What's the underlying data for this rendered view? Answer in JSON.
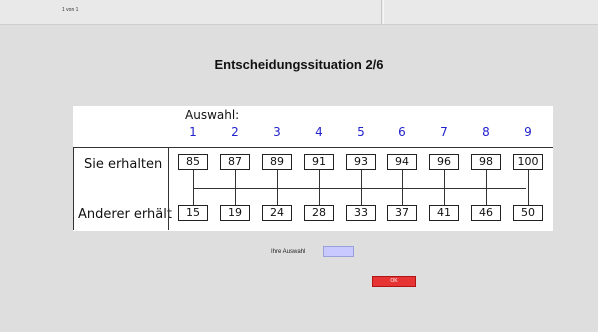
{
  "header": {
    "period_text": "1 von 1"
  },
  "title": "Entscheidungssituation 2/6",
  "table": {
    "auswahl_label": "Auswahl:",
    "options": [
      "1",
      "2",
      "3",
      "4",
      "5",
      "6",
      "7",
      "8",
      "9"
    ],
    "row_self_label": "Sie erhalten",
    "row_other_label": "Anderer erhält",
    "self_values": [
      "85",
      "87",
      "89",
      "91",
      "93",
      "94",
      "96",
      "98",
      "100"
    ],
    "other_values": [
      "15",
      "19",
      "24",
      "28",
      "33",
      "37",
      "41",
      "46",
      "50"
    ]
  },
  "choice": {
    "label": "Ihre Auswahl",
    "value": ""
  },
  "ok_button": {
    "label": "OK"
  },
  "colors": {
    "background": "#dedede",
    "option_numbers": "#2222cc",
    "input_fill": "#c9c9ff",
    "ok_button": "#e63434"
  }
}
